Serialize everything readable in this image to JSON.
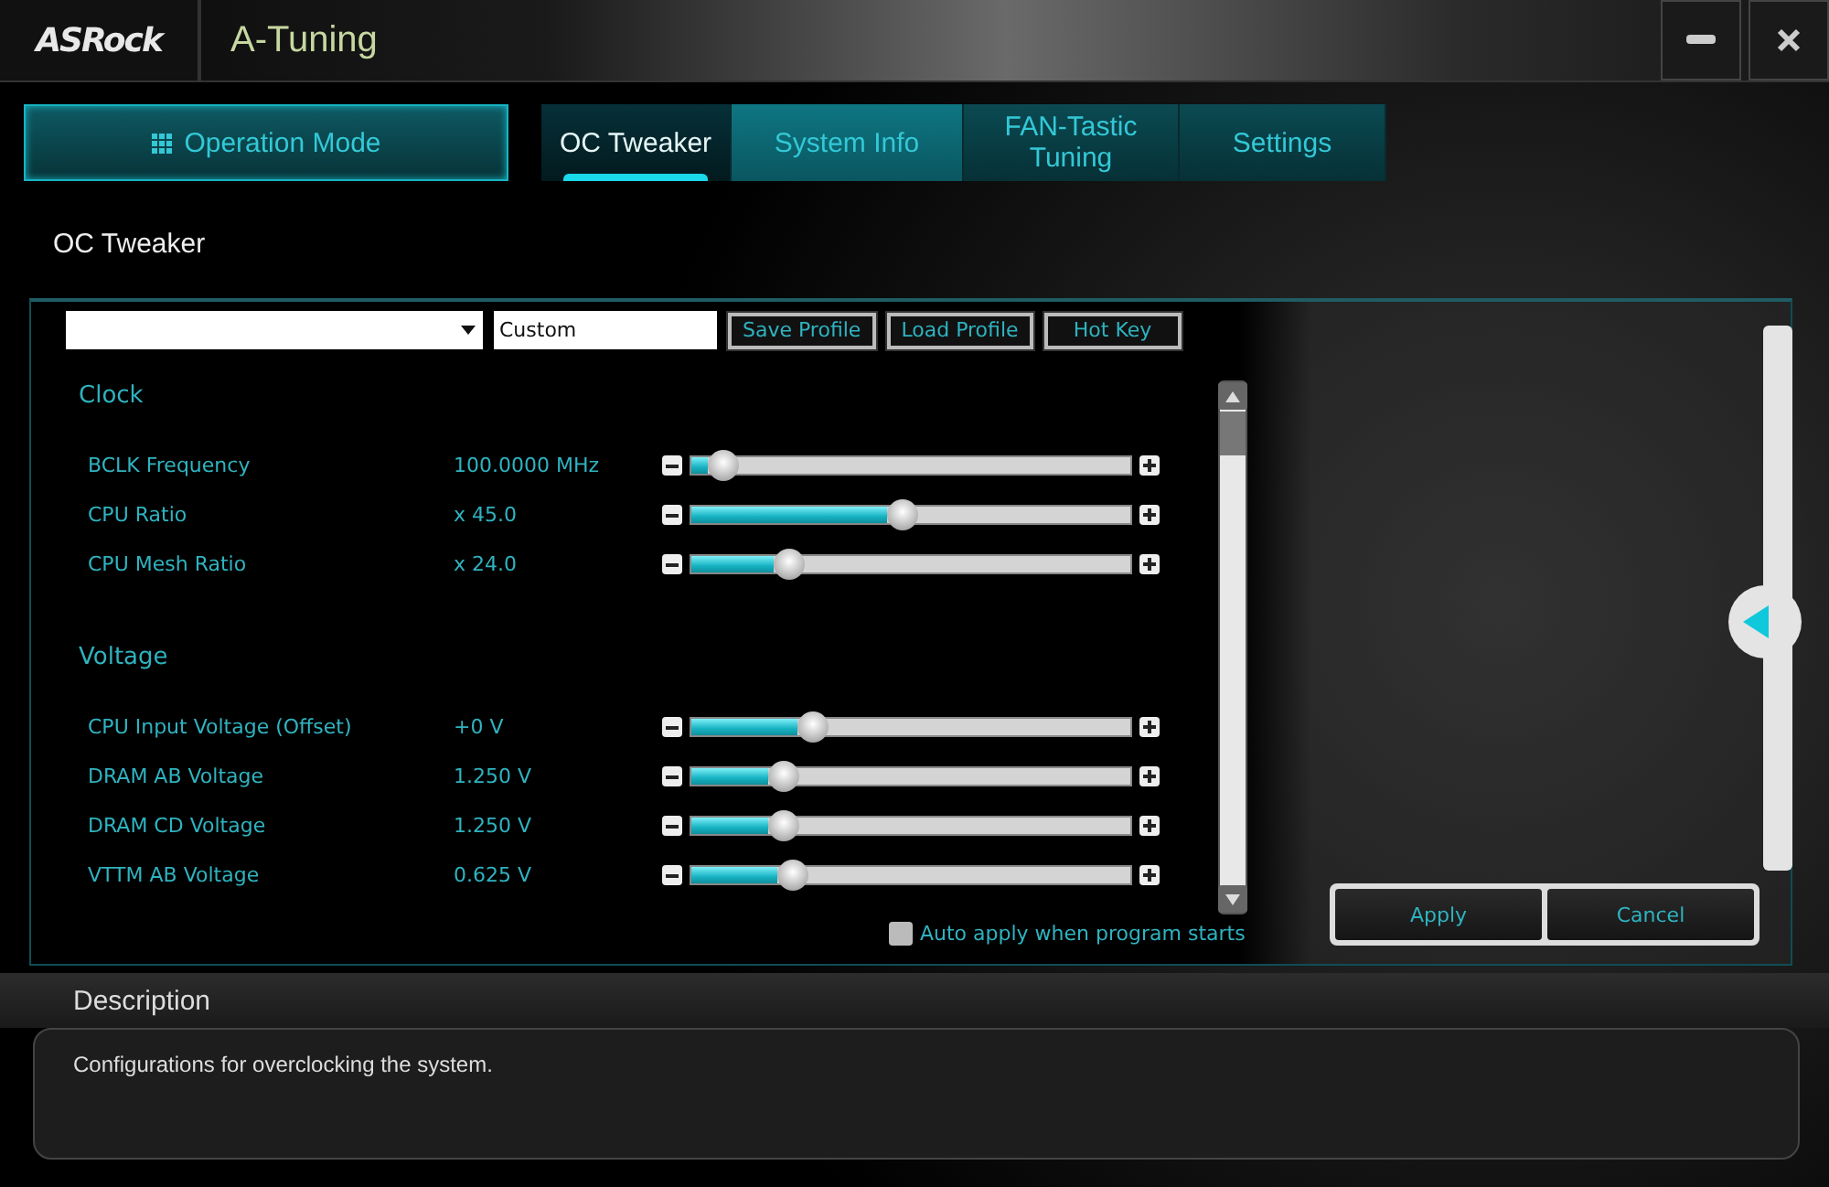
{
  "app": {
    "logo": "ASRock",
    "title": "A-Tuning"
  },
  "nav": {
    "operation_mode": "Operation Mode",
    "tabs": [
      {
        "label": "OC Tweaker",
        "selected": true
      },
      {
        "label": "System Info",
        "selected": false
      },
      {
        "label": "FAN-Tastic Tuning",
        "selected": false
      },
      {
        "label": "Settings",
        "selected": false
      }
    ]
  },
  "page_title": "OC Tweaker",
  "profile": {
    "name_value": "Custom",
    "buttons": [
      "Save Profile",
      "Load Profile",
      "Hot Key"
    ]
  },
  "sections": [
    {
      "title": "Clock",
      "settings": [
        {
          "name": "BCLK Frequency",
          "value": "100.0000 MHz",
          "level": 0.04
        },
        {
          "name": "CPU Ratio",
          "value": "x 45.0",
          "level": 0.48
        },
        {
          "name": "CPU Mesh Ratio",
          "value": "x 24.0",
          "level": 0.2
        }
      ]
    },
    {
      "title": "Voltage",
      "settings": [
        {
          "name": "CPU Input Voltage (Offset)",
          "value": "+0 V",
          "level": 0.26
        },
        {
          "name": "DRAM AB Voltage",
          "value": "1.250 V",
          "level": 0.19
        },
        {
          "name": "DRAM CD Voltage",
          "value": "1.250 V",
          "level": 0.19
        },
        {
          "name": "VTTM AB Voltage",
          "value": "0.625 V",
          "level": 0.21
        }
      ]
    }
  ],
  "auto_apply": {
    "label": "Auto apply when program starts",
    "checked": false
  },
  "actions": [
    "Apply",
    "Cancel"
  ],
  "description": {
    "title": "Description",
    "text": "Configurations for overclocking the system."
  }
}
